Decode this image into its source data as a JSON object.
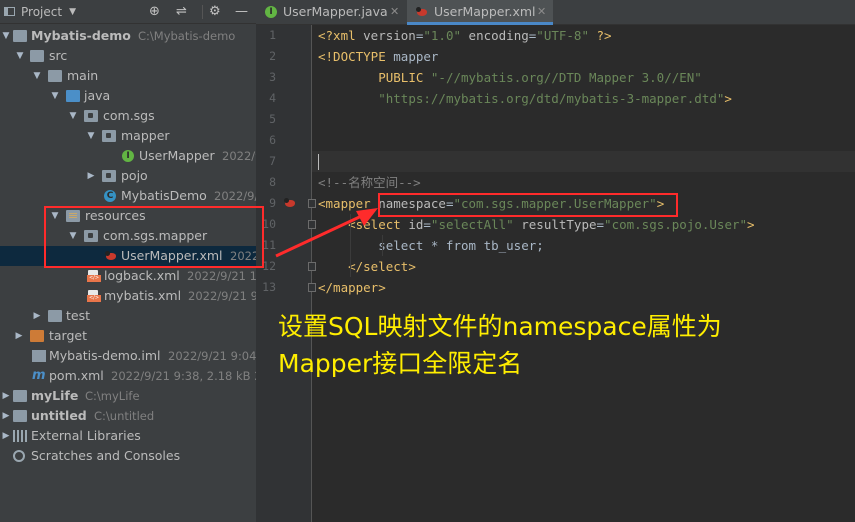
{
  "project_panel": {
    "title": "Project",
    "tools": [
      "⊕",
      "⇌",
      "⚙",
      "—"
    ],
    "tree": [
      {
        "label": "Mybatis-demo",
        "meta": "C:\\Mybatis-demo",
        "icon": "module-folder-icon",
        "bold": true
      },
      {
        "label": "src",
        "meta": "",
        "icon": "folder-icon"
      },
      {
        "label": "main",
        "meta": "",
        "icon": "folder-icon"
      },
      {
        "label": "java",
        "meta": "",
        "icon": "source-folder-icon"
      },
      {
        "label": "com.sgs",
        "meta": "",
        "icon": "package-icon"
      },
      {
        "label": "mapper",
        "meta": "",
        "icon": "package-icon"
      },
      {
        "label": "UserMapper",
        "meta": "2022/9/",
        "icon": "interface-icon"
      },
      {
        "label": "pojo",
        "meta": "",
        "icon": "package-icon"
      },
      {
        "label": "MybatisDemo",
        "meta": "2022/9/2",
        "icon": "class-icon"
      },
      {
        "label": "resources",
        "meta": "",
        "icon": "resources-folder-icon"
      },
      {
        "label": "com.sgs.mapper",
        "meta": "",
        "icon": "package-icon"
      },
      {
        "label": "UserMapper.xml",
        "meta": "2022/",
        "icon": "mybatis-xml-icon"
      },
      {
        "label": "logback.xml",
        "meta": "2022/9/21 12:2",
        "icon": "xml-file-icon"
      },
      {
        "label": "mybatis.xml",
        "meta": "2022/9/21 9:38",
        "icon": "xml-file-icon"
      },
      {
        "label": "test",
        "meta": "",
        "icon": "folder-icon"
      },
      {
        "label": "target",
        "meta": "",
        "icon": "excluded-folder-icon"
      },
      {
        "label": "Mybatis-demo.iml",
        "meta": "2022/9/21 9:04, 1.",
        "icon": "iml-file-icon"
      },
      {
        "label": "pom.xml",
        "meta": "2022/9/21 9:38, 2.18 kB 2022",
        "icon": "maven-icon"
      },
      {
        "label": "myLife",
        "meta": "C:\\myLife",
        "icon": "module-folder-icon",
        "bold": true
      },
      {
        "label": "untitled",
        "meta": "C:\\untitled",
        "icon": "module-folder-icon",
        "bold": true
      },
      {
        "label": "External Libraries",
        "meta": "",
        "icon": "libraries-icon"
      },
      {
        "label": "Scratches and Consoles",
        "meta": "",
        "icon": "scratches-icon"
      }
    ]
  },
  "tabs": [
    {
      "label": "UserMapper.java",
      "icon": "interface-icon",
      "active": false
    },
    {
      "label": "UserMapper.xml",
      "icon": "mybatis-xml-icon",
      "active": true
    }
  ],
  "editor": {
    "line_numbers": [
      "1",
      "2",
      "3",
      "4",
      "5",
      "6",
      "7",
      "8",
      "9",
      "10",
      "11",
      "12",
      "13"
    ],
    "lines": [
      [
        [
          "tag",
          "<?xml "
        ],
        [
          "attr",
          "version"
        ],
        [
          "text",
          "="
        ],
        [
          "str",
          "\"1.0\""
        ],
        [
          "text",
          " "
        ],
        [
          "attr",
          "encoding"
        ],
        [
          "text",
          "="
        ],
        [
          "str",
          "\"UTF-8\""
        ],
        [
          "text",
          " "
        ],
        [
          "tag",
          "?>"
        ]
      ],
      [
        [
          "tag",
          "<!DOCTYPE "
        ],
        [
          "text",
          "mapper"
        ]
      ],
      [
        [
          "text",
          "        "
        ],
        [
          "tag",
          "PUBLIC "
        ],
        [
          "str",
          "\"-//mybatis.org//DTD Mapper 3.0//EN\""
        ]
      ],
      [
        [
          "text",
          "        "
        ],
        [
          "str",
          "\"https://mybatis.org/dtd/mybatis-3-mapper.dtd\""
        ],
        [
          "tag",
          ">"
        ]
      ],
      [],
      [],
      [],
      [
        [
          "comment",
          "<!--名称空间-->"
        ]
      ],
      [
        [
          "tag",
          "<mapper "
        ],
        [
          "attr",
          "namespace"
        ],
        [
          "text",
          "="
        ],
        [
          "str",
          "\"com.sgs.mapper.UserMapper\""
        ],
        [
          "tag",
          ">"
        ]
      ],
      [
        [
          "text",
          "    "
        ],
        [
          "tag",
          "<select "
        ],
        [
          "attr",
          "id"
        ],
        [
          "text",
          "="
        ],
        [
          "str",
          "\"selectAll\""
        ],
        [
          "text",
          " "
        ],
        [
          "attr",
          "resultType"
        ],
        [
          "text",
          "="
        ],
        [
          "str",
          "\"com.sgs.pojo.User\""
        ],
        [
          "tag",
          ">"
        ]
      ],
      [
        [
          "text",
          "        select * from tb_user;"
        ]
      ],
      [
        [
          "text",
          "    "
        ],
        [
          "tag",
          "</select>"
        ]
      ],
      [
        [
          "tag",
          "</mapper>"
        ]
      ]
    ]
  },
  "annotation": {
    "line1": "设置SQL映射文件的namespace属性为",
    "line2": "Mapper接口全限定名"
  },
  "colors": {
    "highlight": "#ff2b2b",
    "annotation_text": "#ffee00"
  }
}
